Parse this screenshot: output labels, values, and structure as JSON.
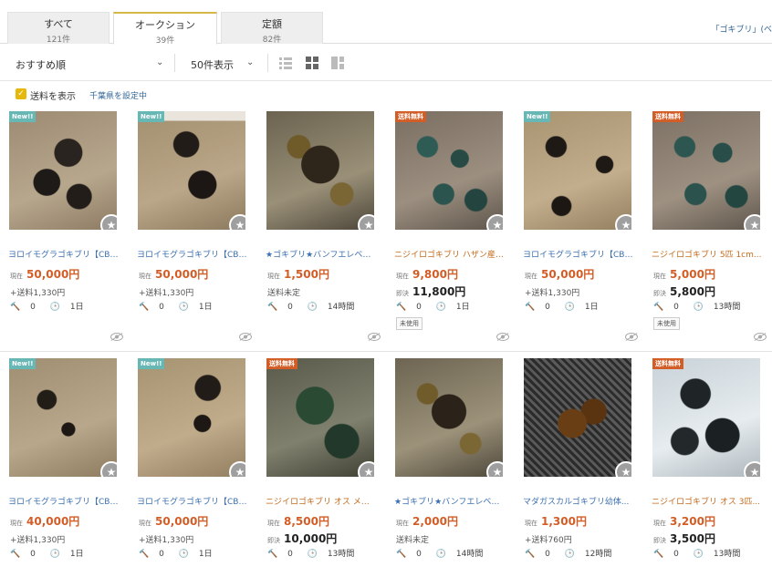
{
  "tabs": [
    {
      "label": "すべて",
      "count": "121件"
    },
    {
      "label": "オークション",
      "count": "39件"
    },
    {
      "label": "定額",
      "count": "82件"
    }
  ],
  "search_term": "「ゴキブリ」(ベ",
  "toolbar": {
    "sort": "おすすめ順",
    "per_page": "50件表示"
  },
  "shipping": {
    "checkbox_label": "送料を表示",
    "location_link": "千葉県を設定中"
  },
  "colors": {
    "accent": "#e7b80c",
    "price": "#d35d26",
    "link": "#3a6fb0"
  },
  "items": [
    {
      "badge": "New!!",
      "title": "ヨロイモグラゴキブリ【CBF...",
      "label1": "現在",
      "price1": "50,000円",
      "line2_label": "",
      "line2_value": "+送料1,330円",
      "bids": "0",
      "time": "1日",
      "condition": ""
    },
    {
      "badge": "New!!",
      "title": "ヨロイモグラゴキブリ【CBF...",
      "label1": "現在",
      "price1": "50,000円",
      "line2_label": "",
      "line2_value": "+送料1,330円",
      "bids": "0",
      "time": "1日",
      "condition": ""
    },
    {
      "badge": "",
      "title": "★ゴキブリ★バンフエレベキ...",
      "label1": "現在",
      "price1": "1,500円",
      "line2_label": "",
      "line2_value": "送料未定",
      "bids": "0",
      "time": "14時間",
      "condition": ""
    },
    {
      "badge": "送料無料",
      "title": "ニジイロゴキブリ ハザン産 1...",
      "label1": "現在",
      "price1": "9,800円",
      "line2_label": "即決",
      "line2_value": "11,800円",
      "bids": "0",
      "time": "1日",
      "condition": "未使用"
    },
    {
      "badge": "New!!",
      "title": "ヨロイモグラゴキブリ【CBF...",
      "label1": "現在",
      "price1": "50,000円",
      "line2_label": "",
      "line2_value": "+送料1,330円",
      "bids": "0",
      "time": "1日",
      "condition": ""
    },
    {
      "badge": "送料無料",
      "title": "ニジイロゴキブリ 5匹 1cm...",
      "label1": "現在",
      "price1": "5,000円",
      "line2_label": "即決",
      "line2_value": "5,800円",
      "bids": "0",
      "time": "13時間",
      "condition": "未使用"
    },
    {
      "badge": "New!!",
      "title": "ヨロイモグラゴキブリ【CBF...",
      "label1": "現在",
      "price1": "40,000円",
      "line2_label": "",
      "line2_value": "+送料1,330円",
      "bids": "0",
      "time": "1日",
      "condition": ""
    },
    {
      "badge": "New!!",
      "title": "ヨロイモグラゴキブリ【CBF...",
      "label1": "現在",
      "price1": "50,000円",
      "line2_label": "",
      "line2_value": "+送料1,330円",
      "bids": "0",
      "time": "1日",
      "condition": ""
    },
    {
      "badge": "送料無料",
      "title": "ニジイロゴキブリ オス メス...",
      "label1": "現在",
      "price1": "8,500円",
      "line2_label": "即決",
      "line2_value": "10,000円",
      "bids": "0",
      "time": "13時間",
      "condition": ""
    },
    {
      "badge": "",
      "title": "★ゴキブリ★バンフエレベキ...",
      "label1": "現在",
      "price1": "2,000円",
      "line2_label": "",
      "line2_value": "送料未定",
      "bids": "0",
      "time": "14時間",
      "condition": ""
    },
    {
      "badge": "",
      "title": "マダガスカルゴキブリ幼体...",
      "label1": "現在",
      "price1": "1,300円",
      "line2_label": "",
      "line2_value": "+送料760円",
      "bids": "0",
      "time": "12時間",
      "condition": ""
    },
    {
      "badge": "送料無料",
      "title": "ニジイロゴキブリ オス 3匹...",
      "label1": "現在",
      "price1": "3,200円",
      "line2_label": "即決",
      "line2_value": "3,500円",
      "bids": "0",
      "time": "13時間",
      "condition": ""
    }
  ]
}
